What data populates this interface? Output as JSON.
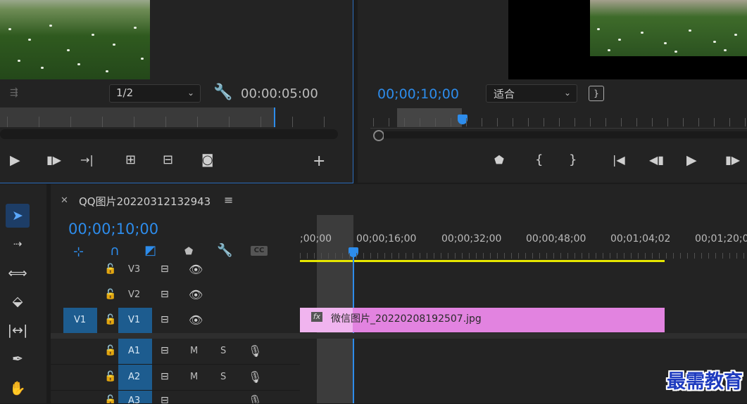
{
  "source_monitor": {
    "resolution": "1/2",
    "duration": "00:00:05:00"
  },
  "program_monitor": {
    "timecode": "00;00;10;00",
    "fit": "适合"
  },
  "timeline": {
    "sequence_name": "QQ图片20220312132943",
    "timecode": "00;00;10;00",
    "ruler_labels": [
      ";00;00",
      "00;00;16;00",
      "00;00;32;00",
      "00;00;48;00",
      "00;01;04;02",
      "00;01;20;0"
    ],
    "video_tracks": [
      {
        "source": "",
        "name": "V3"
      },
      {
        "source": "",
        "name": "V2"
      },
      {
        "source": "V1",
        "name": "V1"
      }
    ],
    "audio_tracks": [
      {
        "name": "A1",
        "mute": "M",
        "solo": "S"
      },
      {
        "name": "A2",
        "mute": "M",
        "solo": "S"
      },
      {
        "name": "A3"
      }
    ],
    "clip": {
      "fx": "fx",
      "name": "微信图片_20220208192507.jpg",
      "color": "#e283e0"
    }
  },
  "watermark": "最需教育",
  "colors": {
    "accent": "#2d8ceb",
    "clip": "#e283e0",
    "work_area": "#e6e600",
    "selected_track": "#1d5c8f"
  }
}
